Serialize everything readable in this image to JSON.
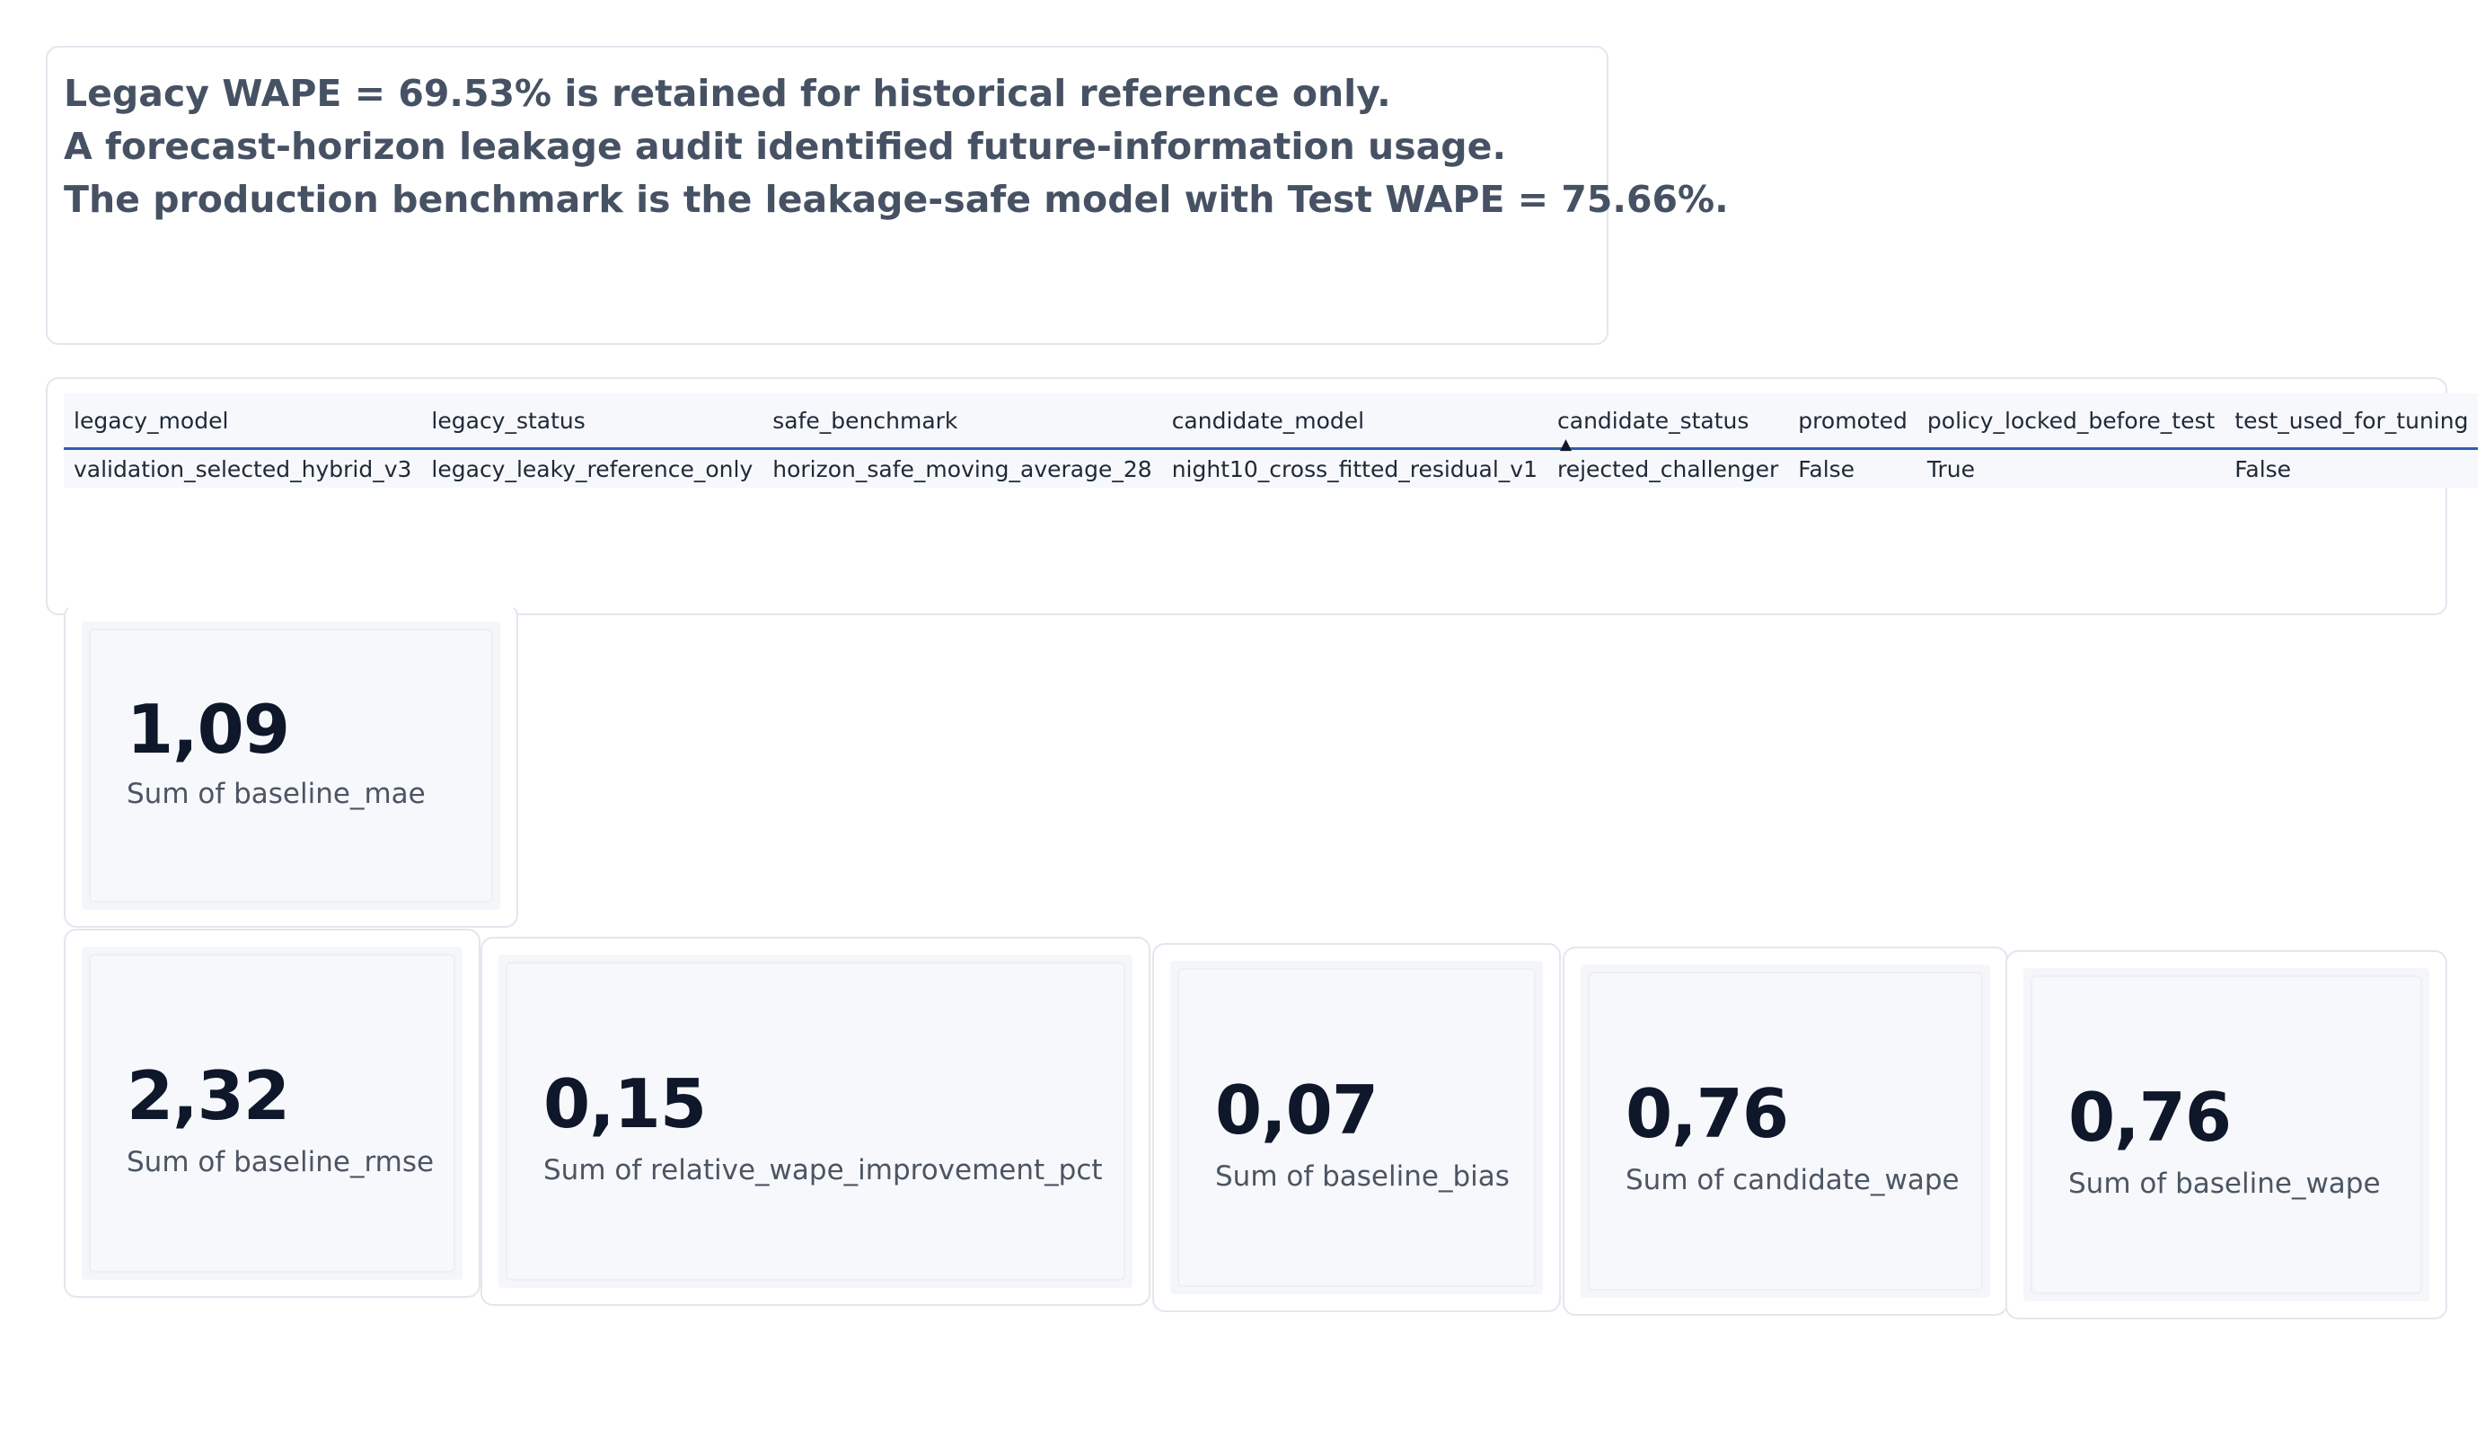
{
  "textbox": {
    "lines": [
      "Legacy WAPE = 69.53% is retained for historical reference only.",
      "A forecast-horizon leakage audit identified future-information usage.",
      "The production benchmark is the leakage-safe model with Test WAPE = 75.66%."
    ]
  },
  "table": {
    "sorted_column": "candidate_status",
    "sort_direction": "ascending",
    "columns": [
      "legacy_model",
      "legacy_status",
      "safe_benchmark",
      "candidate_model",
      "candidate_status",
      "promoted",
      "policy_locked_before_test",
      "test_used_for_tuning"
    ],
    "rows": [
      [
        "validation_selected_hybrid_v3",
        "legacy_leaky_reference_only",
        "horizon_safe_moving_average_28",
        "night10_cross_fitted_residual_v1",
        "rejected_challenger",
        "False",
        "True",
        "False"
      ]
    ]
  },
  "cards": [
    {
      "value": "1,09",
      "label": "Sum of baseline_mae"
    },
    {
      "value": "2,32",
      "label": "Sum of baseline_rmse"
    },
    {
      "value": "0,15",
      "label": "Sum of relative_wape_improvement_pct"
    },
    {
      "value": "0,07",
      "label": "Sum of baseline_bias"
    },
    {
      "value": "0,76",
      "label": "Sum of candidate_wape"
    },
    {
      "value": "0,76",
      "label": "Sum of baseline_wape"
    }
  ],
  "colors": {
    "header_text": "#465263",
    "table_header_border": "#2f5fb3",
    "card_value": "#0f172a",
    "card_label": "#4b5563"
  }
}
